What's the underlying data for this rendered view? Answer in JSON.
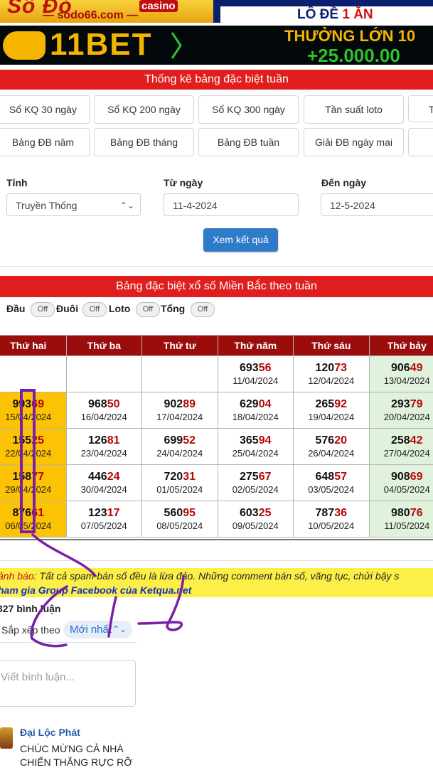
{
  "banners": {
    "top": {
      "brand": "Số Đỏ",
      "casino": "casino",
      "url": "— sodo66.com —",
      "promo_prefix": "LÔ ĐỀ",
      "promo_suffix": "1 ĂN"
    },
    "second": {
      "logo": "11BET",
      "headline": "THƯỞNG LỚN 10",
      "amount": "+25.000.00"
    }
  },
  "stats_header": "Thống kê bảng đặc biệt tuần",
  "quick_links": {
    "row1": [
      "Sổ KQ 30 ngày",
      "Sổ KQ 200 ngày",
      "Sổ KQ 300 ngày",
      "Tần suất loto",
      "T"
    ],
    "row2": [
      "Bảng ĐB năm",
      "Bảng ĐB tháng",
      "Bảng ĐB tuần",
      "Giải ĐB ngày mai"
    ]
  },
  "form": {
    "province_label": "Tỉnh",
    "province_value": "Truyền Thống",
    "from_label": "Từ ngày",
    "from_value": "11-4-2024",
    "to_label": "Đến ngày",
    "to_value": "12-5-2024",
    "submit_label": "Xem kết quả"
  },
  "table_header": "Bảng đặc biệt xổ số Miền Bắc theo tuần",
  "toggles": [
    {
      "label": "Đầu",
      "state": "Off"
    },
    {
      "label": "Đuôi",
      "state": "Off"
    },
    {
      "label": "Loto",
      "state": "Off"
    },
    {
      "label": "Tổng",
      "state": "Off"
    }
  ],
  "table": {
    "columns": [
      "Thứ hai",
      "Thứ ba",
      "Thứ tư",
      "Thứ năm",
      "Thứ sáu",
      "Thứ bảy"
    ],
    "rows": [
      [
        null,
        null,
        null,
        {
          "head": "693",
          "tail": "56",
          "date": "11/04/2024"
        },
        {
          "head": "120",
          "tail": "73",
          "date": "12/04/2024"
        },
        {
          "head": "906",
          "tail": "49",
          "date": "13/04/2024"
        }
      ],
      [
        {
          "head": "993",
          "tail": "69",
          "date": "15/04/2024"
        },
        {
          "head": "968",
          "tail": "50",
          "date": "16/04/2024"
        },
        {
          "head": "902",
          "tail": "89",
          "date": "17/04/2024"
        },
        {
          "head": "629",
          "tail": "04",
          "date": "18/04/2024"
        },
        {
          "head": "265",
          "tail": "92",
          "date": "19/04/2024"
        },
        {
          "head": "293",
          "tail": "79",
          "date": "20/04/2024"
        }
      ],
      [
        {
          "head": "155",
          "tail": "25",
          "date": "22/04/2024"
        },
        {
          "head": "126",
          "tail": "81",
          "date": "23/04/2024"
        },
        {
          "head": "699",
          "tail": "52",
          "date": "24/04/2024"
        },
        {
          "head": "365",
          "tail": "94",
          "date": "25/04/2024"
        },
        {
          "head": "576",
          "tail": "20",
          "date": "26/04/2024"
        },
        {
          "head": "258",
          "tail": "42",
          "date": "27/04/2024"
        }
      ],
      [
        {
          "head": "158",
          "tail": "77",
          "date": "29/04/2024"
        },
        {
          "head": "446",
          "tail": "24",
          "date": "30/04/2024"
        },
        {
          "head": "720",
          "tail": "31",
          "date": "01/05/2024"
        },
        {
          "head": "275",
          "tail": "67",
          "date": "02/05/2024"
        },
        {
          "head": "648",
          "tail": "57",
          "date": "03/05/2024"
        },
        {
          "head": "908",
          "tail": "69",
          "date": "04/05/2024"
        }
      ],
      [
        {
          "head": "876",
          "tail": "61",
          "date": "06/05/2024"
        },
        {
          "head": "123",
          "tail": "17",
          "date": "07/05/2024"
        },
        {
          "head": "560",
          "tail": "95",
          "date": "08/05/2024"
        },
        {
          "head": "603",
          "tail": "25",
          "date": "09/05/2024"
        },
        {
          "head": "787",
          "tail": "36",
          "date": "10/05/2024"
        },
        {
          "head": "980",
          "tail": "76",
          "date": "11/05/2024"
        }
      ]
    ]
  },
  "warning": {
    "label": "ảnh báo",
    "text": ": Tất cả spam bán số đều là lừa đảo. Những comment bán số, văng tục, chửi bậy s",
    "group_link": "ham gia Group Facebook của Ketqua.net"
  },
  "comments": {
    "count_label": "327 bình luận",
    "sort_label": "Sắp xếp theo",
    "sort_value": "Mới nhất",
    "placeholder": "Viết bình luận...",
    "items": [
      {
        "author": "Đại Lộc Phát",
        "lines": [
          "CHÚC MỪNG CẢ NHÀ",
          "CHIẾN THẮNG RỰC RỠ"
        ]
      }
    ]
  },
  "colors": {
    "header_red": "#e01e1e",
    "table_head": "#9b0d0d",
    "monday": "#fcc204",
    "saturday": "#e0f1dc",
    "button_blue": "#2f7ac9",
    "annotation": "#7a1fa8"
  }
}
